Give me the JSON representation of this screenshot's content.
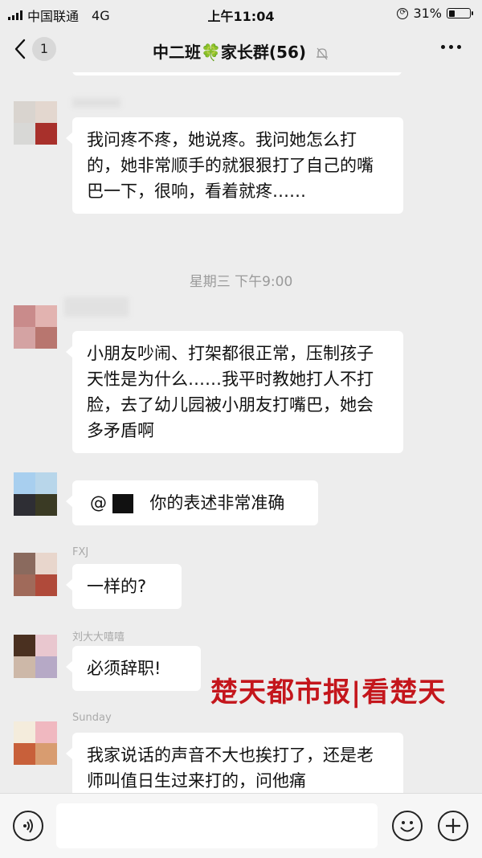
{
  "status_bar": {
    "carrier": "中国联通",
    "network": "4G",
    "time": "上午11:04",
    "battery_percent": "31%",
    "battery_level": 0.31
  },
  "nav": {
    "back_count": "1",
    "title": "中二班🍀家长群(56)"
  },
  "chat": {
    "messages": [
      {
        "nick": "",
        "text": "我问疼不疼，她说疼。我问她怎么打的，她非常顺手的就狠狠打了自己的嘴巴一下，很响，看着就疼……"
      },
      {
        "timestamp": "星期三 下午9:00"
      },
      {
        "nick": "",
        "text": "小朋友吵闹、打架都很正常，压制孩子天性是为什么……我平时教她打人不打脸，去了幼儿园被小朋友打嘴巴，她会多矛盾啊"
      },
      {
        "nick": "",
        "mention": "@",
        "text": "你的表述非常准确"
      },
      {
        "nick": "FXJ",
        "text": "一样的?"
      },
      {
        "nick": "刘大大嘻嘻",
        "text": "必须辞职!"
      },
      {
        "nick": "Sunday",
        "text": "我家说话的声音不大也挨打了，还是老师叫值日生过来打的，问他痛"
      }
    ]
  },
  "watermark": "楚天都市报|看楚天",
  "colors": {
    "background": "#ededed",
    "bubble": "#ffffff",
    "watermark": "#c4161c"
  },
  "icons": {
    "voice": "voice-icon",
    "emoji": "emoji-icon",
    "add": "plus-icon",
    "mute": "mute-bell-icon",
    "more": "more-dots-icon"
  }
}
